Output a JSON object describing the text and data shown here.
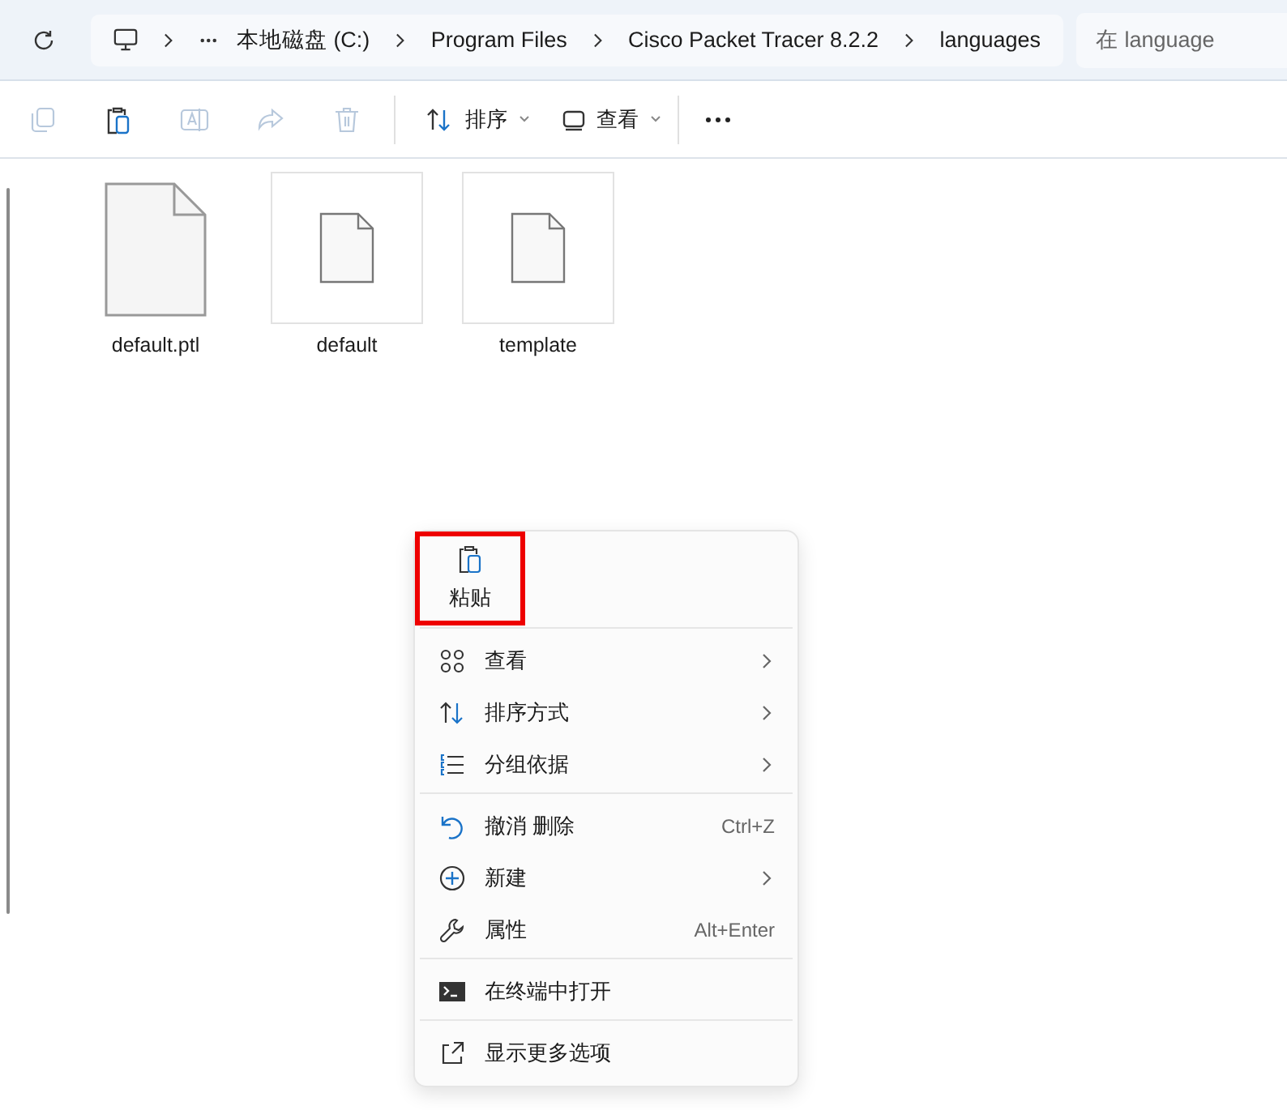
{
  "address_bar": {
    "crumbs": [
      "本地磁盘 (C:)",
      "Program Files",
      "Cisco Packet Tracer 8.2.2",
      "languages"
    ]
  },
  "search": {
    "placeholder": "在 language"
  },
  "toolbar": {
    "buttons": [
      {
        "disabled": true
      },
      {
        "disabled": false
      },
      {
        "disabled": true
      },
      {
        "disabled": true
      },
      {
        "disabled": true
      }
    ],
    "menus": [
      {
        "label": "排序"
      },
      {
        "label": "查看"
      }
    ]
  },
  "files": [
    {
      "name": "default.ptl",
      "kind": "icon"
    },
    {
      "name": "default",
      "kind": "thumbnail"
    },
    {
      "name": "template",
      "kind": "thumbnail"
    }
  ],
  "context_menu": {
    "paste": {
      "label": "粘贴",
      "highlighted": true
    },
    "groups": [
      [
        {
          "label": "查看",
          "submenu": true
        },
        {
          "label": "排序方式",
          "submenu": true
        },
        {
          "label": "分组依据",
          "submenu": true
        }
      ],
      [
        {
          "label": "撤消 删除",
          "shortcut": "Ctrl+Z",
          "submenu": false
        },
        {
          "label": "新建",
          "submenu": true
        },
        {
          "label": "属性",
          "shortcut": "Alt+Enter",
          "submenu": false
        }
      ],
      [
        {
          "label": "在终端中打开",
          "submenu": false
        }
      ],
      [
        {
          "label": "显示更多选项",
          "submenu": false
        }
      ]
    ]
  }
}
